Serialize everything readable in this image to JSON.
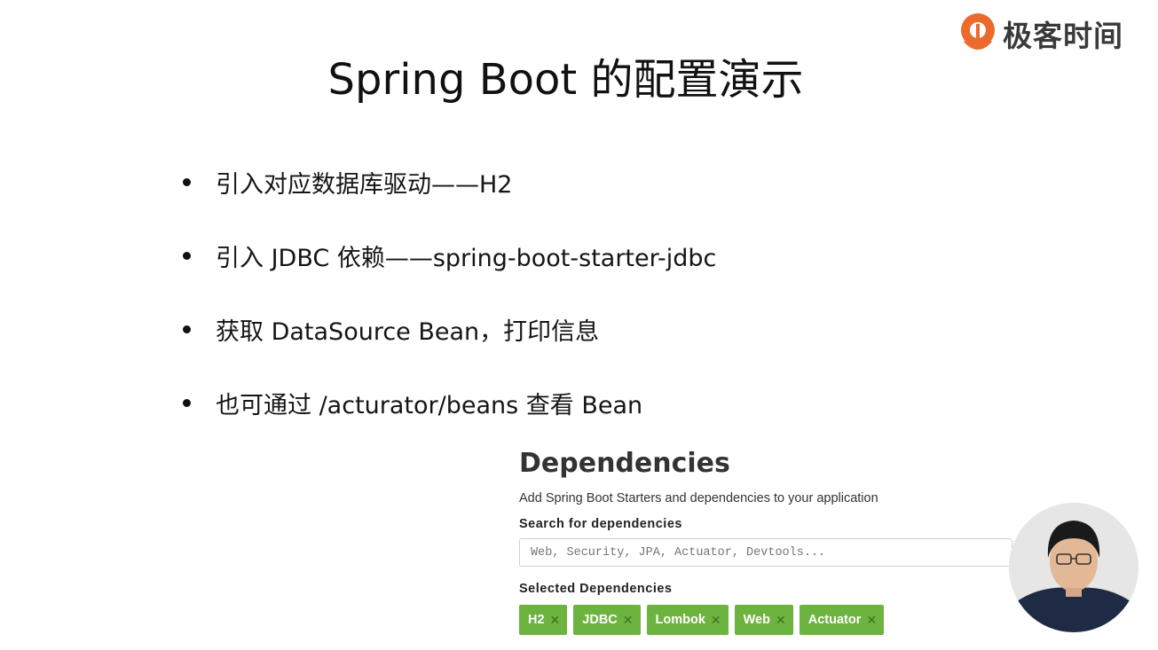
{
  "brand": {
    "name": "极客时间",
    "accent": "#ec6a2c"
  },
  "slide": {
    "title": "Spring Boot 的配置演示",
    "bullets": [
      "引入对应数据库驱动——H2",
      "引入 JDBC 依赖——spring-boot-starter-jdbc",
      "获取 DataSource Bean，打印信息",
      "也可通过 /acturator/beans 查看 Bean"
    ]
  },
  "dependencies": {
    "title": "Dependencies",
    "subtitle": "Add Spring Boot Starters and dependencies to your application",
    "search_label": "Search for dependencies",
    "search_placeholder": "Web, Security, JPA, Actuator, Devtools...",
    "selected_label": "Selected Dependencies",
    "selected": [
      "H2",
      "JDBC",
      "Lombok",
      "Web",
      "Actuator"
    ],
    "remove_glyph": "✕",
    "chip_color": "#6db33f"
  }
}
